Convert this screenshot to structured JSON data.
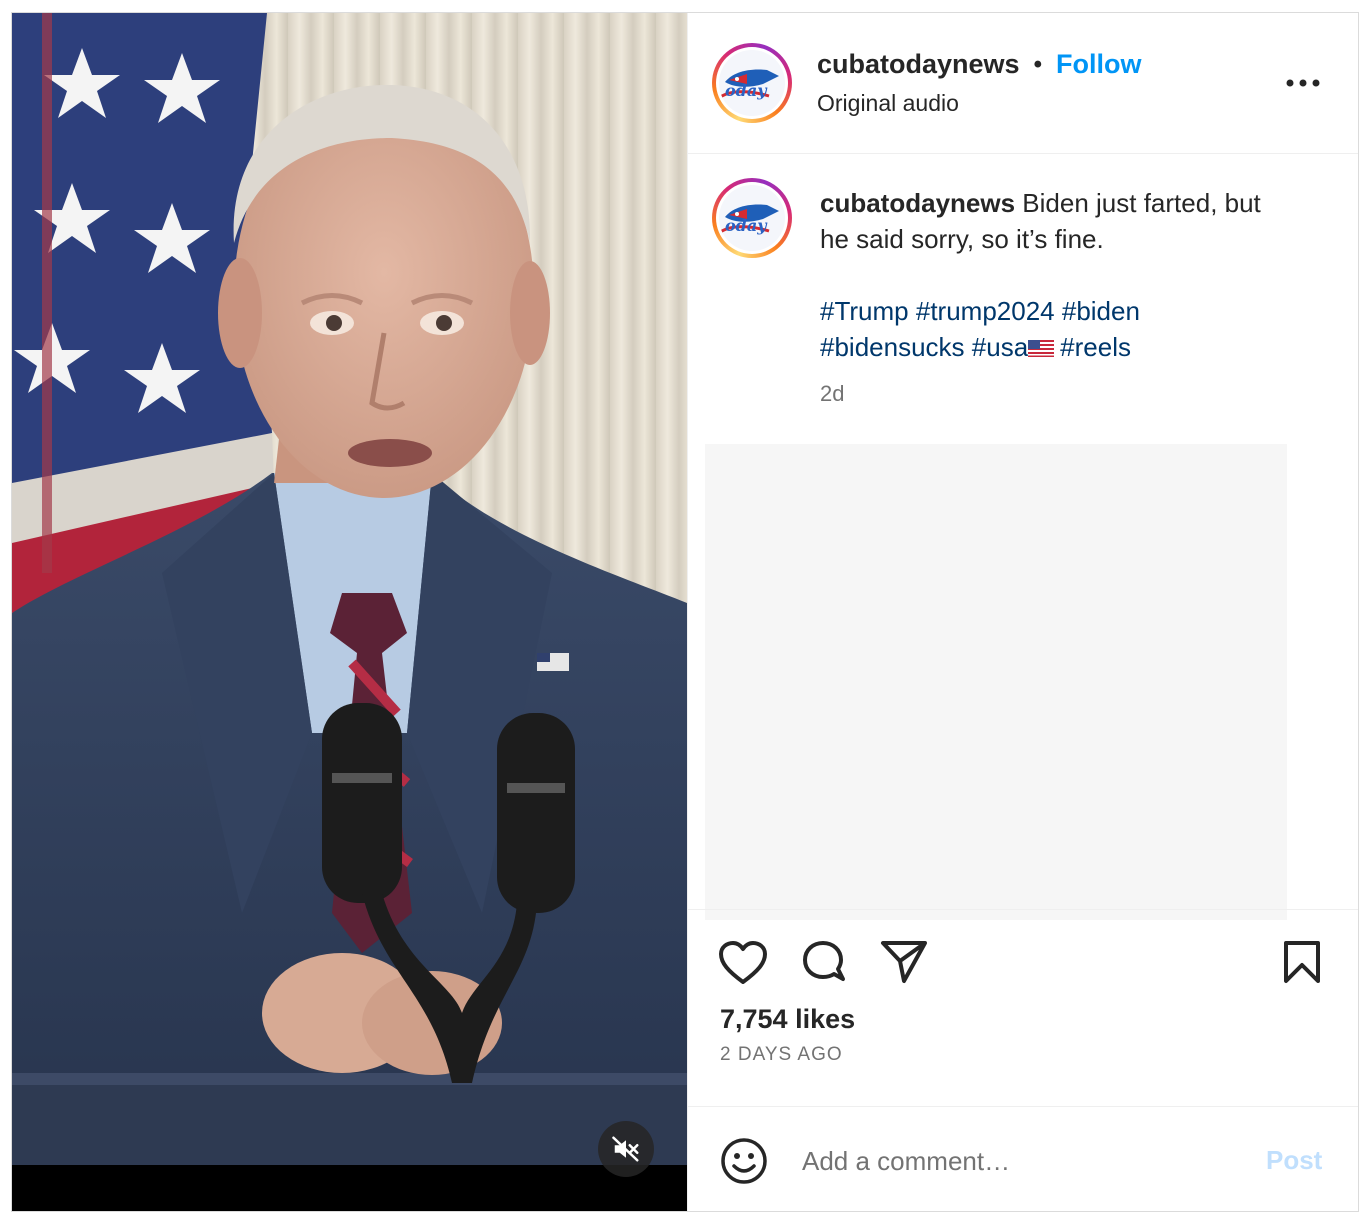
{
  "post": {
    "username": "cubatodaynews",
    "separator": "•",
    "follow_label": "Follow",
    "audio_label": "Original audio",
    "more_icon": "more-horizontal-icon"
  },
  "caption": {
    "username": "cubatodaynews",
    "text": "Biden just farted, but he said sorry, so it’s fine.",
    "hashtags": [
      "#Trump",
      "#trump2024",
      "#biden",
      "#bidensucks",
      "#usa",
      "#reels"
    ],
    "time": "2d"
  },
  "actions": {
    "likes": "7,754 likes",
    "posted": "2 DAYS AGO",
    "icons": [
      "heart-icon",
      "comment-icon",
      "share-icon",
      "bookmark-icon"
    ]
  },
  "comment": {
    "placeholder": "Add a comment…",
    "post_label": "Post",
    "emoji_icon": "smiley-icon"
  },
  "media": {
    "type": "video",
    "muted": true,
    "mute_icon": "speaker-muted-icon"
  },
  "colors": {
    "link_blue": "#0095f6",
    "hashtag_blue": "#00376b",
    "post_disabled": "#c0dffd",
    "border": "#dbdbdb"
  }
}
